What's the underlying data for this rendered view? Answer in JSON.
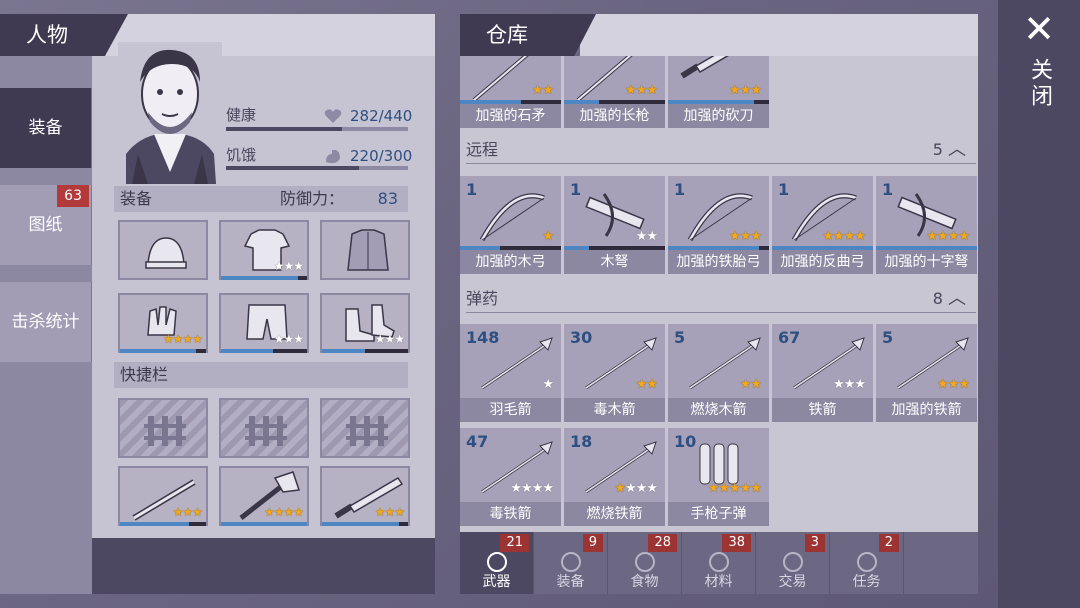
{
  "character": {
    "title": "人物",
    "side_tabs": [
      {
        "label": "装备",
        "active": true,
        "badge": ""
      },
      {
        "label": "图纸",
        "active": false,
        "badge": "63"
      },
      {
        "label": "击杀统计",
        "active": false,
        "badge": ""
      }
    ],
    "health_label": "健康",
    "health_value": "282/440",
    "health_fraction": 0.64,
    "hunger_label": "饥饿",
    "hunger_value": "220/300",
    "hunger_fraction": 0.73,
    "equipment_label": "装备",
    "defense_label": "防御力：",
    "defense_value": "83",
    "quickbar_label": "快捷栏"
  },
  "warehouse": {
    "title": "仓库",
    "top_row": [
      {
        "name": "加强的石矛",
        "stars_gold": 2,
        "stars_white": 0,
        "durability": 0.6
      },
      {
        "name": "加强的长枪",
        "stars_gold": 3,
        "stars_white": 0,
        "durability": 0.35
      },
      {
        "name": "加强的砍刀",
        "stars_gold": 3,
        "stars_white": 0,
        "durability": 0.85
      }
    ],
    "ranged": {
      "label": "远程",
      "count": "5",
      "items": [
        {
          "count": "1",
          "name": "加强的木弓",
          "stars_gold": 1,
          "stars_white": 0,
          "durability": 0.4
        },
        {
          "count": "1",
          "name": "木弩",
          "stars_gold": 0,
          "stars_white": 2,
          "durability": 0.25
        },
        {
          "count": "1",
          "name": "加强的铁胎弓",
          "stars_gold": 3,
          "stars_white": 0,
          "durability": 0.9
        },
        {
          "count": "1",
          "name": "加强的反曲弓",
          "stars_gold": 4,
          "stars_white": 0,
          "durability": 1.0
        },
        {
          "count": "1",
          "name": "加强的十字弩",
          "stars_gold": 4,
          "stars_white": 0,
          "durability": 1.0
        }
      ]
    },
    "ammo": {
      "label": "弹药",
      "count": "8",
      "items": [
        {
          "count": "148",
          "name": "羽毛箭",
          "stars_gold": 0,
          "stars_white": 1
        },
        {
          "count": "30",
          "name": "毒木箭",
          "stars_gold": 2,
          "stars_white": 0
        },
        {
          "count": "5",
          "name": "燃烧木箭",
          "stars_gold": 2,
          "stars_white": 0
        },
        {
          "count": "67",
          "name": "铁箭",
          "stars_gold": 0,
          "stars_white": 3
        },
        {
          "count": "5",
          "name": "加强的铁箭",
          "stars_gold": 3,
          "stars_white": 0
        },
        {
          "count": "47",
          "name": "毒铁箭",
          "stars_gold": 0,
          "stars_white": 4
        },
        {
          "count": "18",
          "name": "燃烧铁箭",
          "stars_gold": 1,
          "stars_white": 3
        },
        {
          "count": "10",
          "name": "手枪子弹",
          "stars_gold": 5,
          "stars_white": 0
        }
      ]
    },
    "bottom_tabs": [
      {
        "label": "武器",
        "badge": "21",
        "active": true
      },
      {
        "label": "装备",
        "badge": "9",
        "active": false
      },
      {
        "label": "食物",
        "badge": "28",
        "active": false
      },
      {
        "label": "材料",
        "badge": "38",
        "active": false
      },
      {
        "label": "交易",
        "badge": "3",
        "active": false
      },
      {
        "label": "任务",
        "badge": "2",
        "active": false
      }
    ]
  },
  "equipment_slots": [
    {
      "item": "hat-icon",
      "stars_gold": 0,
      "stars_white": 0,
      "durability": 0
    },
    {
      "item": "shirt-icon",
      "stars_gold": 0,
      "stars_white": 3,
      "durability": 0.9
    },
    {
      "item": "jacket-icon",
      "stars_gold": 0,
      "stars_white": 0,
      "durability": 0
    },
    {
      "item": "gloves-icon",
      "stars_gold": 4,
      "stars_white": 0,
      "durability": 0.88
    },
    {
      "item": "shorts-icon",
      "stars_gold": 0,
      "stars_white": 3,
      "durability": 0.6
    },
    {
      "item": "boots-icon",
      "stars_gold": 0,
      "stars_white": 3,
      "durability": 0.5
    }
  ],
  "quickbar_slots": [
    {
      "item": "spiked-club-icon",
      "stars_gold": 3,
      "stars_white": 0,
      "durability": 0.8
    },
    {
      "item": "axe-icon",
      "stars_gold": 4,
      "stars_white": 0,
      "durability": 1.0
    },
    {
      "item": "machete-icon",
      "stars_gold": 3,
      "stars_white": 0,
      "durability": 0.9
    }
  ],
  "close": {
    "label": "关闭"
  },
  "colors": {
    "badge": "#b23a3a",
    "accent_blue": "#4d86c2",
    "star_gold": "#f2a81d",
    "dark_panel": "#3f3a52"
  }
}
